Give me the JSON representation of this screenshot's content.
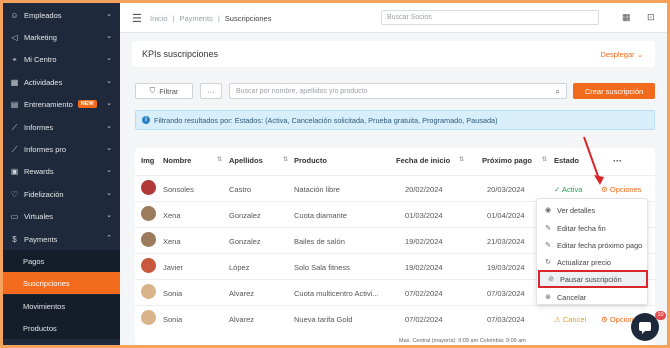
{
  "sidebar": {
    "items": [
      {
        "label": "Empleados",
        "icon": "users-icon",
        "chev": "⌄"
      },
      {
        "label": "Marketing",
        "icon": "megaphone-icon",
        "chev": "⌄"
      },
      {
        "label": "Mi Centro",
        "icon": "location-icon",
        "chev": "⌄"
      },
      {
        "label": "Actividades",
        "icon": "grid-icon",
        "chev": "⌄"
      },
      {
        "label": "Entrenamiento",
        "icon": "training-icon",
        "chev": "⌄",
        "badge": "NEW"
      },
      {
        "label": "Informes",
        "icon": "chart-icon",
        "chev": "⌄"
      },
      {
        "label": "Informes pro",
        "icon": "chart-pro-icon",
        "chev": "⌄"
      },
      {
        "label": "Rewards",
        "icon": "gift-icon",
        "chev": "⌄"
      },
      {
        "label": "Fidelización",
        "icon": "heart-icon",
        "chev": "⌄"
      },
      {
        "label": "Virtuales",
        "icon": "video-icon",
        "chev": "⌄"
      },
      {
        "label": "Payments",
        "icon": "payments-icon",
        "chev": "⌃"
      }
    ],
    "subitems": [
      {
        "label": "Pagos",
        "active": false
      },
      {
        "label": "Suscripciones",
        "active": true
      },
      {
        "label": "Movimientos",
        "active": false
      },
      {
        "label": "Productos",
        "active": false
      }
    ]
  },
  "topbar": {
    "breadcrumb": [
      "Inicio",
      "Payments",
      "Suscripciones"
    ],
    "search_placeholder": "Buscar Socios"
  },
  "kpi": {
    "title": "KPIs suscripciones",
    "toggle": "Desplegar"
  },
  "toolbar": {
    "filter_label": "Filtrar",
    "more_label": "···",
    "search_placeholder": "Buscar por nombre, apellidos y/o producto",
    "create_label": "Crear suscripción"
  },
  "info": {
    "text": "Filtrando resultados por: Estados: (Activa, Cancelación solicitada, Prueba gratuita, Programado, Pausada)"
  },
  "table": {
    "headers": [
      "Img",
      "Nombre",
      "Apellidos",
      "Producto",
      "Fecha de inicio",
      "Próximo pago",
      "Estado",
      "···"
    ],
    "rows": [
      {
        "nombre": "Sonsoles",
        "apellidos": "Castro",
        "producto": "Natación libre",
        "inicio": "20/02/2024",
        "proximo": "20/03/2024",
        "estado": "Activa",
        "opciones": "Opciones",
        "avatar_color": "#b03a3a"
      },
      {
        "nombre": "Xena",
        "apellidos": "Gonzalez",
        "producto": "Cuota diamante",
        "inicio": "01/03/2024",
        "proximo": "01/04/2024",
        "estado": "",
        "opciones": "",
        "avatar_color": "#9c7a5c"
      },
      {
        "nombre": "Xena",
        "apellidos": "Gonzalez",
        "producto": "Bailes de salón",
        "inicio": "19/02/2024",
        "proximo": "21/03/2024",
        "estado": "",
        "opciones": "",
        "avatar_color": "#9c7a5c"
      },
      {
        "nombre": "Javier",
        "apellidos": "López",
        "producto": "Solo Sala fitness",
        "inicio": "19/02/2024",
        "proximo": "19/03/2024",
        "estado": "",
        "opciones": "",
        "avatar_color": "#c8573c"
      },
      {
        "nombre": "Sonia",
        "apellidos": "Alvarez",
        "producto": "Cuota multicentro Activi...",
        "inicio": "07/02/2024",
        "proximo": "07/03/2024",
        "estado": "",
        "opciones": "",
        "avatar_color": "#d9b48a"
      },
      {
        "nombre": "Sonia",
        "apellidos": "Alvarez",
        "producto": "Nueva tarifa Gold",
        "inicio": "07/02/2024",
        "proximo": "07/03/2024",
        "estado": "Cancel",
        "opciones": "Opcion",
        "avatar_color": "#d9b48a"
      }
    ]
  },
  "dropdown": {
    "items": [
      {
        "label": "Ver detalles",
        "icon": "eye-icon",
        "glyph": "◉"
      },
      {
        "label": "Editar fecha fin",
        "icon": "pencil-icon",
        "glyph": "✎"
      },
      {
        "label": "Editar fecha próximo pago",
        "icon": "pencil-icon",
        "glyph": "✎"
      },
      {
        "label": "Actualizar precio",
        "icon": "refresh-icon",
        "glyph": "↻"
      },
      {
        "label": "Pausar suscripción",
        "icon": "pause-icon",
        "glyph": "⊘",
        "highlighted": true
      },
      {
        "label": "Cancelar",
        "icon": "cancel-icon",
        "glyph": "⊗"
      }
    ]
  },
  "chat": {
    "badge": "10"
  },
  "footer_strip": "Max. Central (mayoría): 9:09 am   Colombia: 9:09 am",
  "colors": {
    "accent": "#f26b1d",
    "sidebar": "#1e2a3b",
    "highlight": "#d8262b"
  }
}
